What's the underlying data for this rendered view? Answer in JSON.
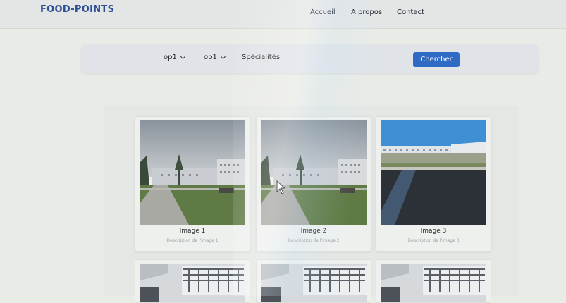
{
  "navbar": {
    "brand": "FOOD-POINTS",
    "links": [
      "Accueil",
      "A propos",
      "Contact"
    ]
  },
  "filters": {
    "dropdown1": "op1",
    "dropdown2": "op1",
    "specialites_label": "Spécialités",
    "search_button": "Chercher"
  },
  "gallery": {
    "cards": [
      {
        "title": "Image 1",
        "description": "Description de l'image 1"
      },
      {
        "title": "Image 2",
        "description": "Description de l'image 2"
      },
      {
        "title": "Image 3",
        "description": "Description de l'image 3"
      }
    ]
  },
  "colors": {
    "brand": "#2c4f93",
    "accent_button": "#2f6ac4"
  }
}
